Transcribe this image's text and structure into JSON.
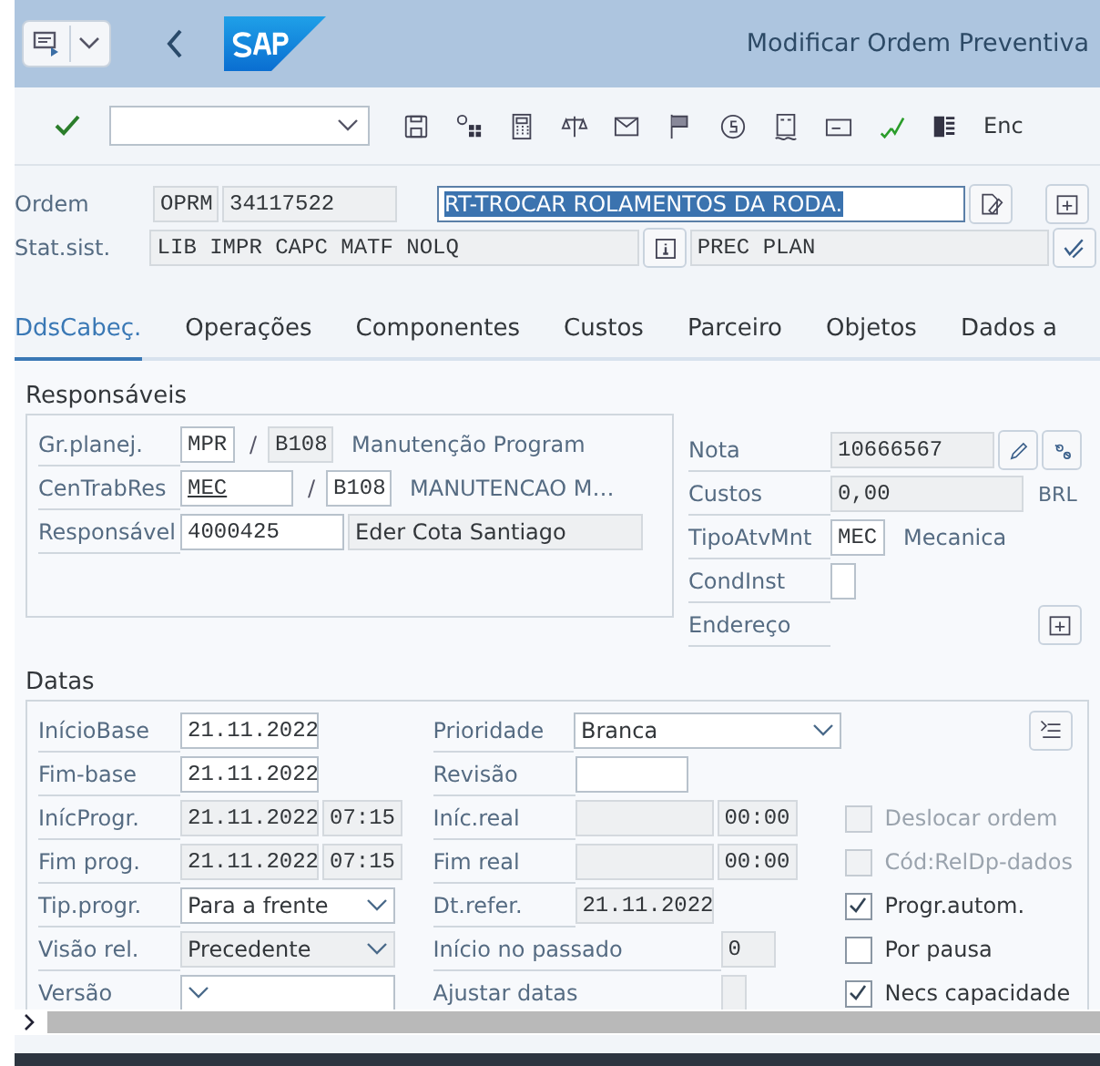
{
  "header": {
    "title": "Modificar Ordem Preventiva"
  },
  "toolbar": {
    "overflow_label": "Enc"
  },
  "order": {
    "label": "Ordem",
    "type": "OPRM",
    "number": "34117522",
    "description": "RT-TROCAR ROLAMENTOS DA RODA.",
    "description_selected": true
  },
  "status": {
    "label": "Stat.sist.",
    "system_status": "LIB  IMPR CAPC MATF NOLQ",
    "user_status": "PREC PLAN"
  },
  "tabs": [
    {
      "label": "DdsCabeç.",
      "selected": true
    },
    {
      "label": "Operações",
      "selected": false
    },
    {
      "label": "Componentes",
      "selected": false
    },
    {
      "label": "Custos",
      "selected": false
    },
    {
      "label": "Parceiro",
      "selected": false
    },
    {
      "label": "Objetos",
      "selected": false
    },
    {
      "label": "Dados a",
      "selected": false
    }
  ],
  "responsaveis": {
    "title": "Responsáveis",
    "planner_group": {
      "label": "Gr.planej.",
      "code": "MPR",
      "separator": "/",
      "plant": "B108",
      "text": "Manutenção Program"
    },
    "work_center": {
      "label": "CenTrabRes",
      "code": "MEC",
      "separator": "/",
      "plant": "B108",
      "text": "MANUTENCAO M…"
    },
    "responsible": {
      "label": "Responsável",
      "code": "4000425",
      "name": "Eder Cota Santiago"
    }
  },
  "side": {
    "nota": {
      "label": "Nota",
      "value": "10666567"
    },
    "custos": {
      "label": "Custos",
      "value": "0,00",
      "currency": "BRL"
    },
    "tipo": {
      "label": "TipoAtvMnt",
      "code": "MEC",
      "text": "Mecanica"
    },
    "condinst": {
      "label": "CondInst"
    },
    "endereco": {
      "label": "Endereço"
    }
  },
  "datas": {
    "title": "Datas",
    "left": [
      {
        "label": "InícioBase",
        "kind": "date",
        "value": "21.11.2022",
        "editable": true
      },
      {
        "label": "Fim-base",
        "kind": "date",
        "value": "21.11.2022",
        "editable": true
      },
      {
        "label": "InícProgr.",
        "kind": "datetime",
        "value": "21.11.2022",
        "time": "07:15",
        "editable": false
      },
      {
        "label": "Fim prog.",
        "kind": "datetime",
        "value": "21.11.2022",
        "time": "07:15",
        "editable": false
      },
      {
        "label": "Tip.progr.",
        "kind": "select",
        "value": "Para a frente",
        "editable": true
      },
      {
        "label": "Visão rel.",
        "kind": "select",
        "value": "Precedente",
        "editable": false
      },
      {
        "label": "Versão",
        "kind": "select",
        "editable": true
      }
    ],
    "middle": [
      {
        "label": "Prioridade",
        "kind": "select",
        "value": "Branca",
        "editable": true
      },
      {
        "label": "Revisão",
        "kind": "text",
        "editable": true
      },
      {
        "label": "Iníc.real",
        "kind": "datetime",
        "time": "00:00",
        "editable": false
      },
      {
        "label": "Fim real",
        "kind": "datetime",
        "time": "00:00",
        "editable": false
      },
      {
        "label": "Dt.refer.",
        "kind": "date",
        "value": "21.11.2022",
        "editable": false
      },
      {
        "label": "Início no passado",
        "kind": "small",
        "value": "0",
        "editable": false
      },
      {
        "label": "Ajustar datas",
        "kind": "tiny",
        "editable": false
      }
    ],
    "checks": [
      {
        "label": "Deslocar ordem",
        "checked": false,
        "disabled": true
      },
      {
        "label": "Cód:RelDp-dados",
        "checked": false,
        "disabled": true
      },
      {
        "label": "Progr.autom.",
        "checked": true,
        "disabled": false
      },
      {
        "label": "Por pausa",
        "checked": false,
        "disabled": false
      },
      {
        "label": "Necs capacidade",
        "checked": true,
        "disabled": false
      }
    ]
  }
}
